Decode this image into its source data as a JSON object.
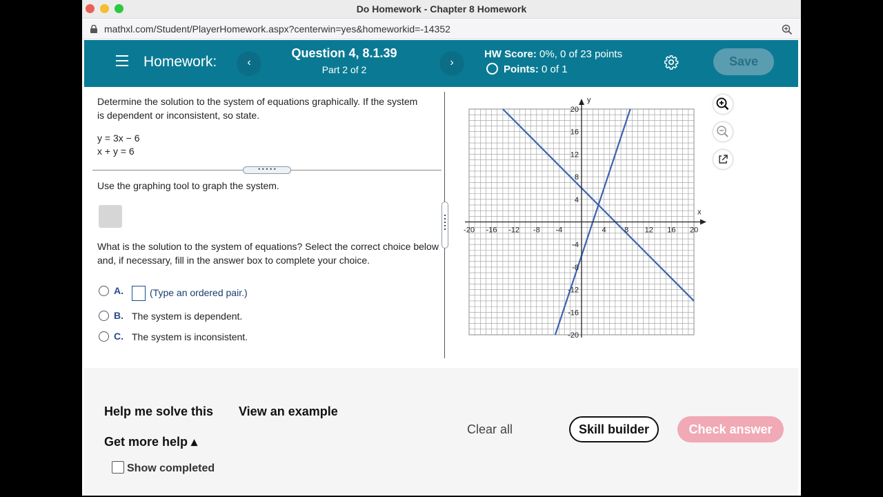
{
  "window": {
    "title": "Do Homework - Chapter 8 Homework",
    "url": "mathxl.com/Student/PlayerHomework.aspx?centerwin=yes&homeworkid=-14352"
  },
  "header": {
    "homework_label": "Homework:",
    "prev_icon": "‹",
    "next_icon": "›",
    "question_title": "Question 4, 8.1.39",
    "question_part": "Part 2 of 2",
    "hw_score_label": "HW Score:",
    "hw_score_value": "0%, 0 of 23 points",
    "points_label": "Points:",
    "points_value": "0 of 1",
    "save_label": "Save"
  },
  "question": {
    "prompt": "Determine the solution to the system of equations graphically. If the system is dependent or inconsistent, so state.",
    "equation_1": "y = 3x − 6",
    "equation_2": "x + y = 6",
    "handle_dots": "• • • • •",
    "graph_instruction": "Use the graphing tool to graph the system.",
    "solution_prompt": "What is the solution to the system of equations? Select the correct choice below and, if necessary, fill in the answer box to complete your choice.",
    "choices": [
      {
        "letter": "A.",
        "text": "(Type an ordered pair.)"
      },
      {
        "letter": "B.",
        "text": "The system is dependent."
      },
      {
        "letter": "C.",
        "text": "The system is inconsistent."
      }
    ]
  },
  "graph": {
    "x_axis_label": "x",
    "y_axis_label": "y",
    "x_ticks": [
      "-20",
      "-16",
      "-12",
      "-8",
      "-4",
      "4",
      "8",
      "12",
      "16",
      "20"
    ],
    "y_ticks": [
      "20",
      "16",
      "12",
      "8",
      "4",
      "-4",
      "-8",
      "-12",
      "-16",
      "-20"
    ],
    "line_color": "#3a63b0",
    "lines": [
      {
        "equation": "y = 3x − 6",
        "x": [
          -4.67,
          8.67
        ],
        "y": [
          -20,
          20
        ]
      },
      {
        "equation": "x + y = 6",
        "x": [
          -14,
          20
        ],
        "y": [
          20,
          -14
        ]
      }
    ]
  },
  "footer": {
    "help_solve": "Help me solve this",
    "view_example": "View an example",
    "more_help": "Get more help ▴",
    "show_completed": "Show completed",
    "clear_all": "Clear all",
    "skill_builder": "Skill builder",
    "check_answer": "Check answer"
  }
}
